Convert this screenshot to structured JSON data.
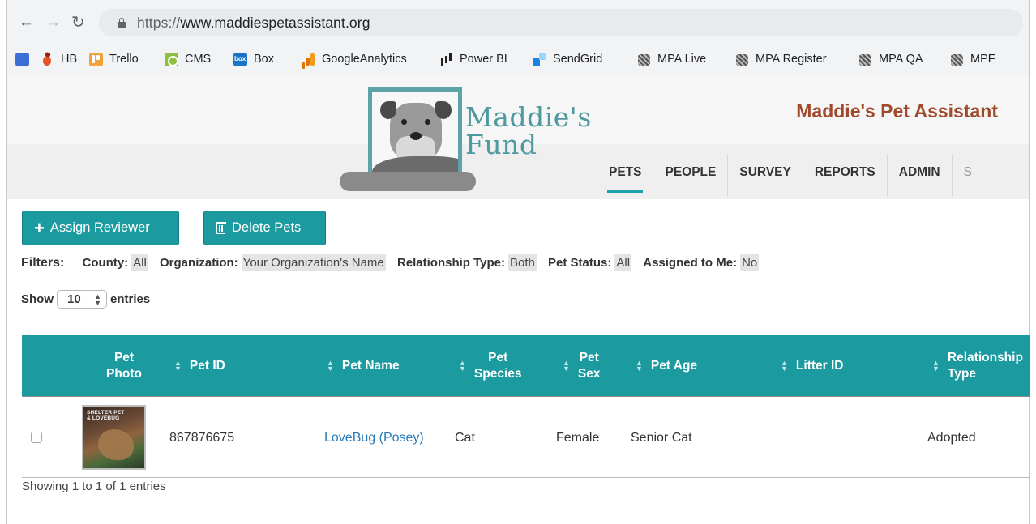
{
  "browser": {
    "url_scheme": "https://",
    "url_rest": "www.maddiespetassistant.org",
    "bookmarks": [
      {
        "label": "",
        "icon": "google-docs-icon"
      },
      {
        "label": "HB",
        "icon": "hb-icon"
      },
      {
        "label": "Trello",
        "icon": "trello-icon"
      },
      {
        "label": "CMS",
        "icon": "cms-icon"
      },
      {
        "label": "Box",
        "icon": "box-icon"
      },
      {
        "label": "GoogleAnalytics",
        "icon": "google-analytics-icon"
      },
      {
        "label": "Power BI",
        "icon": "power-bi-icon"
      },
      {
        "label": "SendGrid",
        "icon": "sendgrid-icon"
      },
      {
        "label": "MPA Live",
        "icon": "mpa-icon"
      },
      {
        "label": "MPA Register",
        "icon": "mpa-icon"
      },
      {
        "label": "MPA QA",
        "icon": "mpa-icon"
      },
      {
        "label": "MPF",
        "icon": "mpa-icon"
      }
    ]
  },
  "header": {
    "logo_line1": "Maddie's",
    "logo_line2": "Fund",
    "app_title": "Maddie's Pet Assistant",
    "nav": [
      "PETS",
      "PEOPLE",
      "SURVEY",
      "REPORTS",
      "ADMIN",
      "S"
    ],
    "active_nav": "PETS"
  },
  "toolbar": {
    "assign_label": "Assign Reviewer",
    "delete_label": "Delete Pets"
  },
  "filters": {
    "label": "Filters:",
    "items": [
      {
        "key": "County:",
        "value": "All"
      },
      {
        "key": "Organization:",
        "value": "Your Organization's Name"
      },
      {
        "key": "Relationship Type:",
        "value": "Both"
      },
      {
        "key": "Pet Status:",
        "value": "All"
      },
      {
        "key": "Assigned to Me:",
        "value": "No"
      }
    ]
  },
  "entries": {
    "show_label": "Show",
    "value": "10",
    "suffix": "entries"
  },
  "table": {
    "columns": [
      "Pet Photo",
      "Pet ID",
      "Pet Name",
      "Pet Species",
      "Pet Sex",
      "Pet Age",
      "Litter ID",
      "Relationship Type"
    ],
    "column_lines": [
      [
        "Pet",
        "Photo"
      ],
      [
        "Pet ID"
      ],
      [
        "Pet Name"
      ],
      [
        "Pet",
        "Species"
      ],
      [
        "Pet",
        "Sex"
      ],
      [
        "Pet Age"
      ],
      [
        "Litter ID"
      ],
      [
        "Relationship",
        "Type"
      ]
    ],
    "rows": [
      {
        "photo_caption_1": "SHELTER PET",
        "photo_caption_2": "& LOVEBUG",
        "pet_id": "867876675",
        "pet_name": "LoveBug (Posey)",
        "species": "Cat",
        "sex": "Female",
        "age": "Senior Cat",
        "litter_id": "",
        "relationship_type": "Adopted"
      }
    ],
    "info": "Showing 1 to 1 of 1 entries"
  },
  "colors": {
    "teal": "#1b9aa0",
    "brand_red": "#a0492b",
    "link": "#2a7ab8"
  }
}
